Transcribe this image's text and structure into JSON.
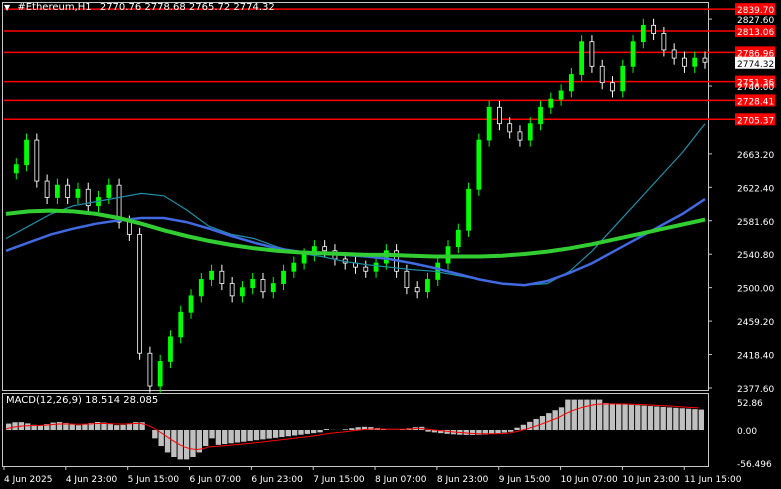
{
  "header": {
    "arrow_icon": "triangle-down-icon",
    "symbol": "#Ethereum,H1",
    "ohlc": "2770.76 2778.68 2765.72 2774.32"
  },
  "macd": {
    "label": "MACD(12,26,9) 18.514 28.085",
    "axis_labels": [
      "52.86",
      "0.00",
      "-56.496"
    ]
  },
  "price_axis_labels": [
    "2827.60",
    "2774.32",
    "2746.00",
    "2663.20",
    "2622.40",
    "2581.60",
    "2540.80",
    "2500.00",
    "2459.20",
    "2418.40",
    "2377.60"
  ],
  "horizontal_levels": [
    {
      "label": "2839.70",
      "price": 2839.7
    },
    {
      "label": "2813.06",
      "price": 2813.06
    },
    {
      "label": "2786.96",
      "price": 2786.96
    },
    {
      "label": "2751.36",
      "price": 2751.36
    },
    {
      "label": "2728.41",
      "price": 2728.41
    },
    {
      "label": "2705.37",
      "price": 2705.37
    }
  ],
  "current_price": "2774.32",
  "time_axis_labels": [
    "4 Jun 2025",
    "4 Jun 23:00",
    "5 Jun 15:00",
    "6 Jun 07:00",
    "6 Jun 23:00",
    "7 Jun 15:00",
    "8 Jun 07:00",
    "8 Jun 23:00",
    "9 Jun 15:00",
    "10 Jun 07:00",
    "10 Jun 23:00",
    "11 Jun 15:00"
  ],
  "colors": {
    "background": "#000000",
    "bull_candle": "#00ff00",
    "bear_candle": "#ffffff",
    "level_line": "#ff0000",
    "ma_fast": "#1e90a8",
    "ma_mid": "#4169e1",
    "ma_slow": "#32cd32",
    "macd_hist": "#c0c0c0",
    "macd_signal": "#ff0000"
  },
  "chart_data": {
    "type": "line",
    "title": "#Ethereum,H1",
    "ylim": [
      2377.6,
      2846
    ],
    "close_path": [
      2640,
      2650,
      2680,
      2630,
      2610,
      2625,
      2610,
      2620,
      2600,
      2610,
      2625,
      2580,
      2565,
      2420,
      2380,
      2410,
      2440,
      2470,
      2490,
      2510,
      2520,
      2505,
      2490,
      2500,
      2510,
      2495,
      2505,
      2520,
      2530,
      2540,
      2550,
      2545,
      2535,
      2530,
      2525,
      2520,
      2530,
      2545,
      2520,
      2500,
      2495,
      2510,
      2530,
      2550,
      2570,
      2620,
      2680,
      2720,
      2700,
      2690,
      2680,
      2700,
      2720,
      2730,
      2740,
      2760,
      2800,
      2770,
      2750,
      2740,
      2770,
      2800,
      2820,
      2810,
      2790,
      2780,
      2770,
      2780,
      2775
    ],
    "series": [
      {
        "values": [
          2560,
          2575,
          2590,
          2600,
          2605,
          2610,
          2615,
          2612,
          2595,
          2575,
          2565,
          2560,
          2550,
          2542,
          2538,
          2532,
          2528,
          2525,
          2522,
          2520,
          2515,
          2510,
          2505,
          2503,
          2505,
          2520,
          2545,
          2575,
          2605,
          2635,
          2665,
          2700
        ]
      },
      {
        "values": [
          2545,
          2555,
          2565,
          2572,
          2578,
          2582,
          2585,
          2585,
          2580,
          2572,
          2563,
          2555,
          2548,
          2544,
          2542,
          2540,
          2538,
          2535,
          2530,
          2524,
          2517,
          2510,
          2505,
          2503,
          2508,
          2518,
          2530,
          2545,
          2560,
          2575,
          2590,
          2608
        ]
      },
      {
        "values": [
          2590,
          2593,
          2594,
          2593,
          2590,
          2585,
          2578,
          2570,
          2563,
          2557,
          2552,
          2548,
          2545,
          2543,
          2542,
          2541,
          2540,
          2540,
          2539,
          2538,
          2538,
          2538,
          2539,
          2541,
          2544,
          2548,
          2553,
          2559,
          2565,
          2571,
          2577,
          2583
        ]
      }
    ]
  }
}
